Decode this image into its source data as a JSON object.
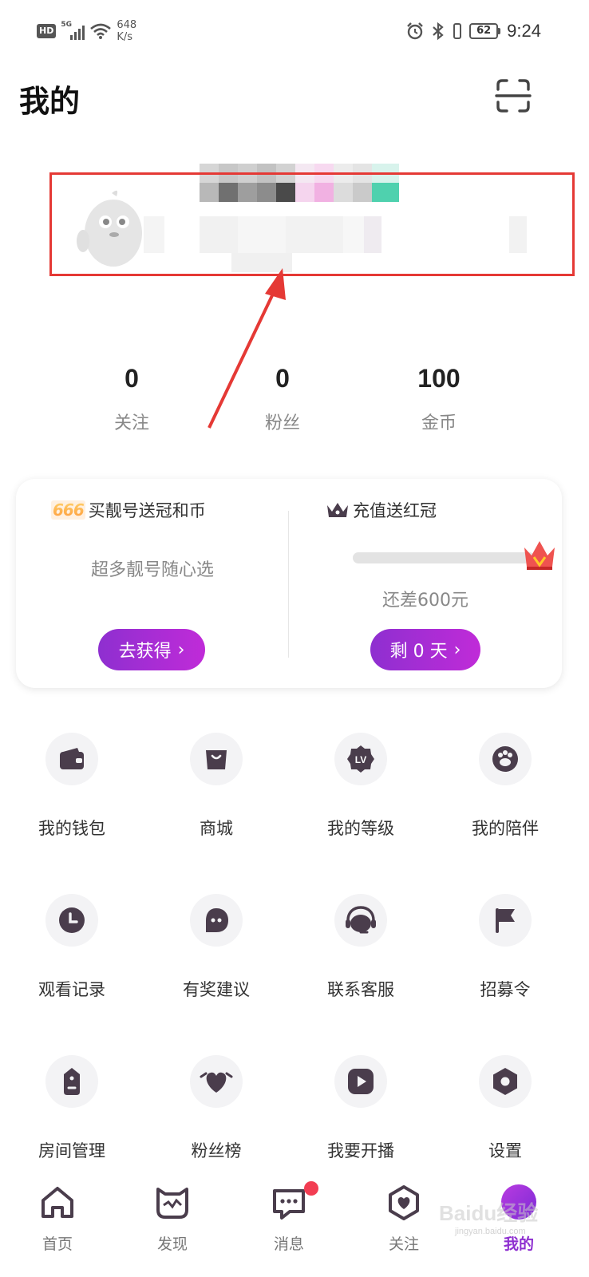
{
  "status_bar": {
    "hd": "HD",
    "network": "5G",
    "speed_value": "648",
    "speed_unit": "K/s",
    "battery": "62",
    "time": "9:24"
  },
  "header": {
    "title": "我的",
    "scan_icon": "scan-icon"
  },
  "profile": {
    "avatar_icon": "mascot-avatar"
  },
  "stats": [
    {
      "value": "0",
      "label": "关注"
    },
    {
      "value": "0",
      "label": "粉丝"
    },
    {
      "value": "100",
      "label": "金币"
    }
  ],
  "promo": {
    "left": {
      "badge": "666",
      "title": "买靓号送冠和币",
      "subtitle": "超多靓号随心选",
      "button": "去获得",
      "button_chevron": "›"
    },
    "right": {
      "title": "充值送红冠",
      "progress_fraction": 0.0,
      "remain": "还差600元",
      "button": "剩 0 天",
      "button_chevron": "›"
    }
  },
  "grid": [
    {
      "label": "我的钱包",
      "icon": "wallet-icon"
    },
    {
      "label": "商城",
      "icon": "shopping-bag-icon"
    },
    {
      "label": "我的等级",
      "icon": "level-badge-icon"
    },
    {
      "label": "我的陪伴",
      "icon": "paw-icon"
    },
    {
      "label": "观看记录",
      "icon": "clock-icon"
    },
    {
      "label": "有奖建议",
      "icon": "chat-bubble-icon"
    },
    {
      "label": "联系客服",
      "icon": "headset-icon"
    },
    {
      "label": "招募令",
      "icon": "flag-icon"
    },
    {
      "label": "房间管理",
      "icon": "tag-icon"
    },
    {
      "label": "粉丝榜",
      "icon": "heart-icon"
    },
    {
      "label": "我要开播",
      "icon": "play-icon"
    },
    {
      "label": "设置",
      "icon": "settings-icon"
    }
  ],
  "bottom_nav": [
    {
      "label": "首页",
      "icon": "home-icon"
    },
    {
      "label": "发现",
      "icon": "discover-cat-icon"
    },
    {
      "label": "消息",
      "icon": "message-icon"
    },
    {
      "label": "关注",
      "icon": "follow-heart-icon"
    },
    {
      "label": "我的",
      "icon": "me-icon"
    }
  ],
  "watermark": {
    "text": "Baidu经验",
    "sub": "jingyan.baidu.com"
  },
  "colors": {
    "accent_purple": "#8e2fd0",
    "accent_magenta": "#c02bd8",
    "highlight_red": "#e53935",
    "icon_dark": "#4a3d4c"
  }
}
